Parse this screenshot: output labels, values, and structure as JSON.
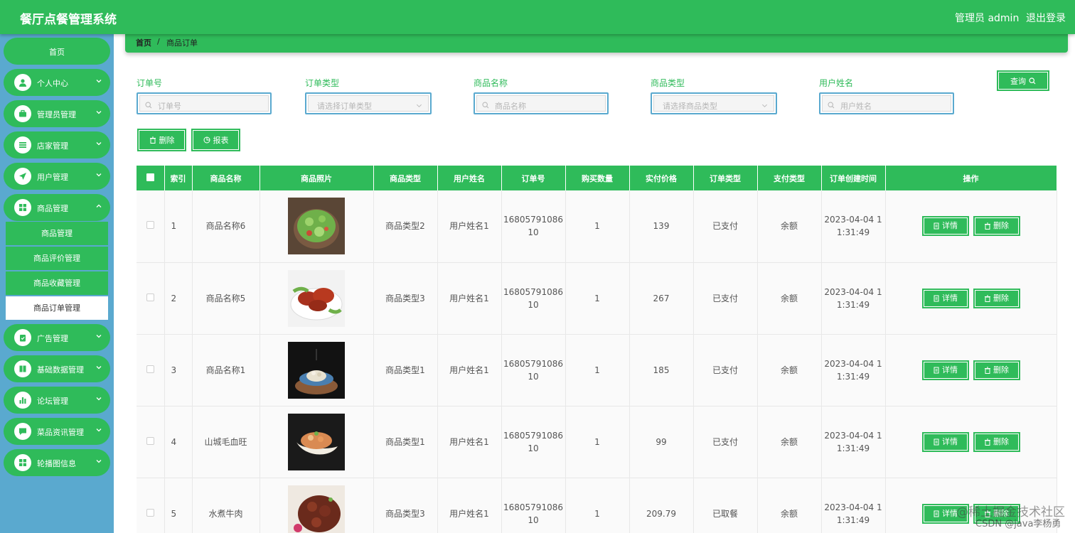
{
  "app": {
    "title": "餐厅点餐管理系统",
    "user_label": "管理员 admin",
    "logout_label": "退出登录"
  },
  "sidebar": {
    "home": "首页",
    "items": [
      {
        "label": "个人中心",
        "icon": "user-icon"
      },
      {
        "label": "管理员管理",
        "icon": "briefcase-icon"
      },
      {
        "label": "店家管理",
        "icon": "list-icon"
      },
      {
        "label": "用户管理",
        "icon": "send-icon"
      },
      {
        "label": "商品管理",
        "icon": "grid-icon"
      },
      {
        "label": "广告管理",
        "icon": "clipboard-icon"
      },
      {
        "label": "基础数据管理",
        "icon": "book-icon"
      },
      {
        "label": "论坛管理",
        "icon": "chart-icon"
      },
      {
        "label": "菜品资讯管理",
        "icon": "message-icon"
      },
      {
        "label": "轮播图信息",
        "icon": "grid-icon"
      }
    ],
    "submenu": [
      "商品管理",
      "商品评价管理",
      "商品收藏管理",
      "商品订单管理"
    ]
  },
  "breadcrumb": {
    "home": "首页",
    "separator": "/",
    "current": "商品订单"
  },
  "filters": [
    {
      "label": "订单号",
      "placeholder": "订单号",
      "kind": "input"
    },
    {
      "label": "订单类型",
      "placeholder": "请选择订单类型",
      "kind": "select"
    },
    {
      "label": "商品名称",
      "placeholder": "商品名称",
      "kind": "input"
    },
    {
      "label": "商品类型",
      "placeholder": "请选择商品类型",
      "kind": "select"
    },
    {
      "label": "用户姓名",
      "placeholder": "用户姓名",
      "kind": "input"
    }
  ],
  "buttons": {
    "query": "查询",
    "delete": "删除",
    "report": "报表",
    "detail": "详情",
    "row_delete": "删除"
  },
  "table": {
    "headers": [
      "",
      "索引",
      "商品名称",
      "商品照片",
      "商品类型",
      "用户姓名",
      "订单号",
      "购买数量",
      "实付价格",
      "订单类型",
      "支付类型",
      "订单创建时间",
      "操作"
    ],
    "rows": [
      {
        "index": "1",
        "name": "商品名称6",
        "type": "商品类型2",
        "user": "用户姓名1",
        "order_no": "1680579108610",
        "qty": "1",
        "price": "139",
        "order_type": "已支付",
        "pay_type": "余额",
        "created": "2023-04-04 11:31:49",
        "photo": "salad-icon"
      },
      {
        "index": "2",
        "name": "商品名称5",
        "type": "商品类型3",
        "user": "用户姓名1",
        "order_no": "1680579108610",
        "qty": "1",
        "price": "267",
        "order_type": "已支付",
        "pay_type": "余额",
        "created": "2023-04-04 11:31:49",
        "photo": "roast-meat-icon"
      },
      {
        "index": "3",
        "name": "商品名称1",
        "type": "商品类型1",
        "user": "用户姓名1",
        "order_no": "1680579108610",
        "qty": "1",
        "price": "185",
        "order_type": "已支付",
        "pay_type": "余额",
        "created": "2023-04-04 11:31:49",
        "photo": "plated-dish-icon"
      },
      {
        "index": "4",
        "name": "山城毛血旺",
        "type": "商品类型1",
        "user": "用户姓名1",
        "order_no": "1680579108610",
        "qty": "1",
        "price": "99",
        "order_type": "已支付",
        "pay_type": "余额",
        "created": "2023-04-04 11:31:49",
        "photo": "shellfish-dish-icon"
      },
      {
        "index": "5",
        "name": "水煮牛肉",
        "type": "商品类型3",
        "user": "用户姓名1",
        "order_no": "1680579108610",
        "qty": "1",
        "price": "209.79",
        "order_type": "已取餐",
        "pay_type": "余额",
        "created": "2023-04-04 11:31:49",
        "photo": "beef-dish-icon"
      }
    ]
  },
  "watermark": {
    "line1": "@稀土掘金技术社区",
    "line2": "CSDN @java李杨勇"
  },
  "colors": {
    "primary": "#2fbb5a",
    "sidebar": "#5aa9cf",
    "input_border": "#5aa9cf"
  }
}
